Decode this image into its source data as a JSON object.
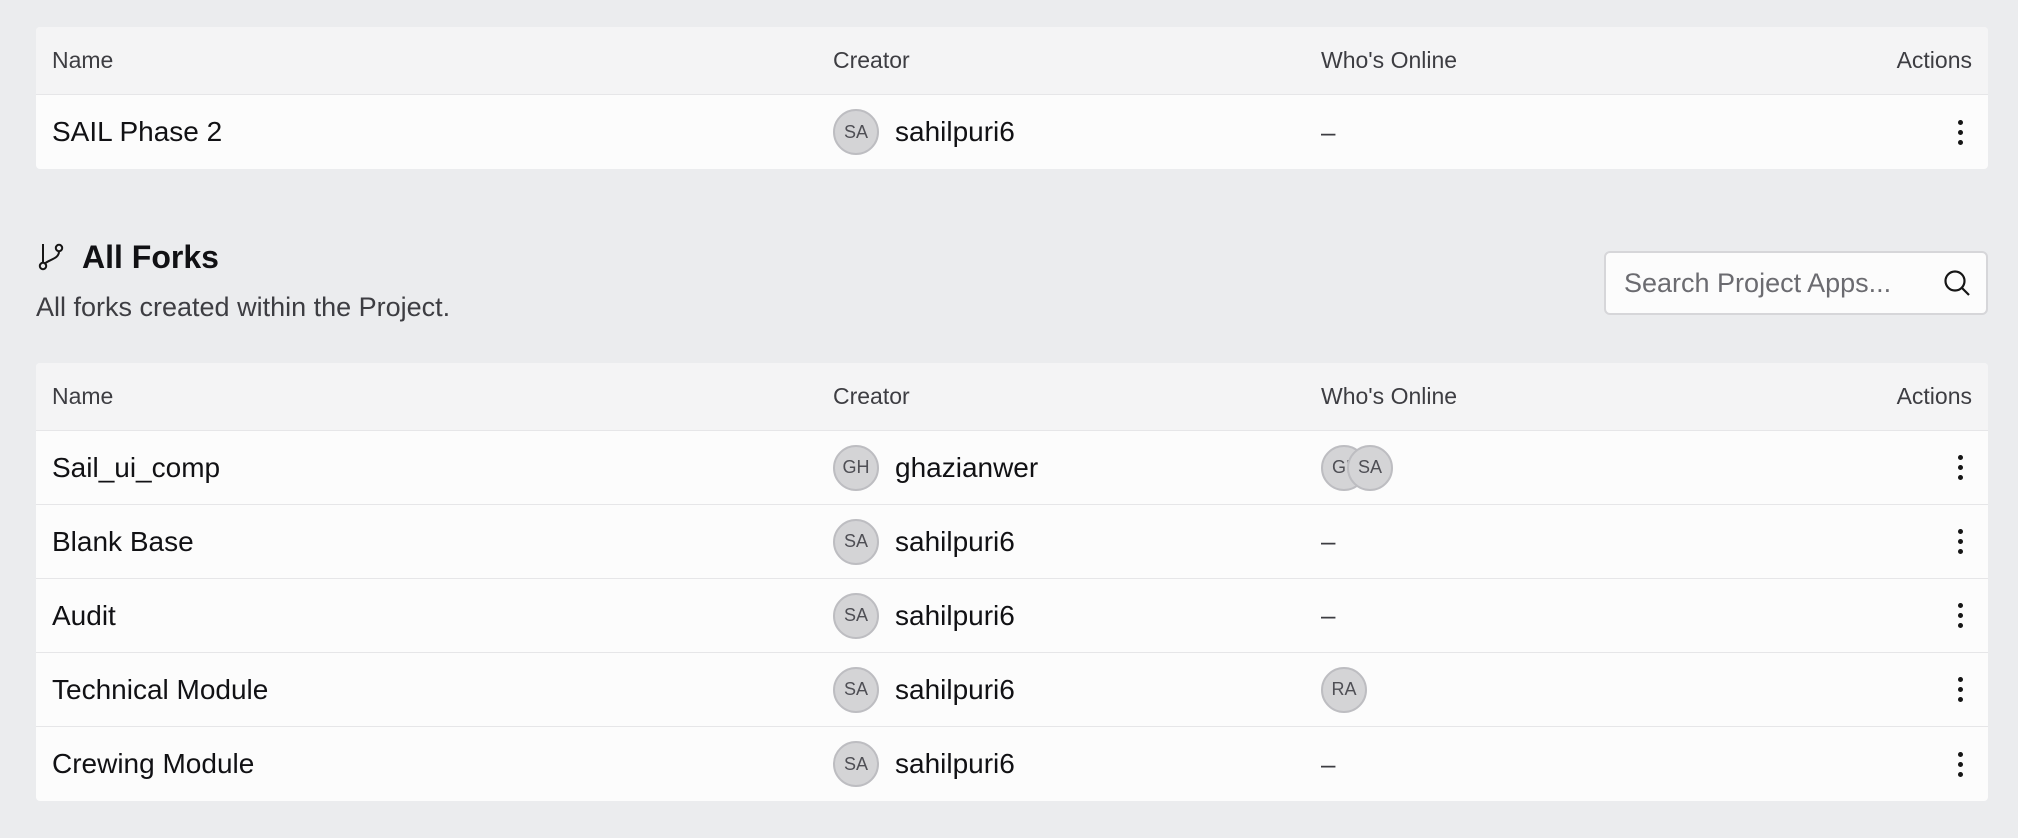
{
  "table_columns": {
    "name": "Name",
    "creator": "Creator",
    "online": "Who's Online",
    "actions": "Actions"
  },
  "top_table": {
    "rows": [
      {
        "name": "SAIL Phase 2",
        "creator_initials": "SA",
        "creator": "sahilpuri6",
        "online": "–"
      }
    ]
  },
  "forks_section": {
    "icon": "git-fork-icon",
    "title": "All Forks",
    "description": "All forks created within the Project.",
    "search_placeholder": "Search Project Apps...",
    "search_icon": "search-icon"
  },
  "forks_table": {
    "rows": [
      {
        "name": "Sail_ui_comp",
        "creator_initials": "GH",
        "creator": "ghazianwer",
        "online_avatars": [
          "GH",
          "SA"
        ]
      },
      {
        "name": "Blank Base",
        "creator_initials": "SA",
        "creator": "sahilpuri6",
        "online": "–"
      },
      {
        "name": "Audit",
        "creator_initials": "SA",
        "creator": "sahilpuri6",
        "online": "–"
      },
      {
        "name": "Technical Module",
        "creator_initials": "SA",
        "creator": "sahilpuri6",
        "online_avatars": [
          "RA"
        ]
      },
      {
        "name": "Crewing Module",
        "creator_initials": "SA",
        "creator": "sahilpuri6",
        "online": "–"
      }
    ]
  },
  "colors": {
    "page_background": "#ebecee",
    "panel_background": "#fcfcfc",
    "header_background": "#f4f4f5",
    "avatar_background": "#d4d4d6"
  }
}
